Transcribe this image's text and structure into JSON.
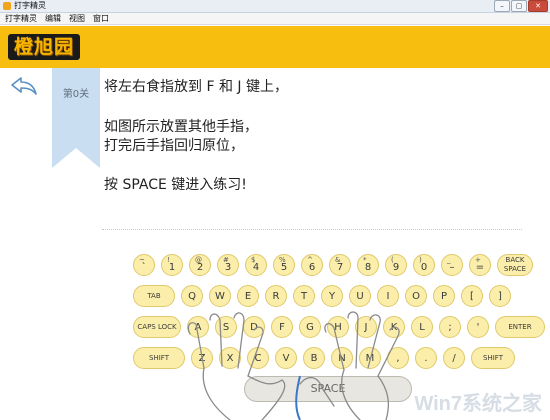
{
  "window": {
    "title": "打字精灵",
    "buttons": [
      "–",
      "▢",
      "✕"
    ]
  },
  "menu": [
    "打字精灵",
    "编辑",
    "视图",
    "窗口"
  ],
  "logo": "橙旭园",
  "lesson": {
    "label": "第0关"
  },
  "instructions": {
    "line1": "将左右食指放到 F 和 J 键上，",
    "line2": "如图所示放置其他手指，",
    "line3": "打完后手指回归原位，",
    "line4": "按 SPACE 键进入练习!"
  },
  "keyboard": {
    "row1": [
      {
        "top": "~",
        "main": "`"
      },
      {
        "top": "!",
        "main": "1"
      },
      {
        "top": "@",
        "main": "2"
      },
      {
        "top": "#",
        "main": "3"
      },
      {
        "top": "$",
        "main": "4"
      },
      {
        "top": "%",
        "main": "5"
      },
      {
        "top": "^",
        "main": "6"
      },
      {
        "top": "&",
        "main": "7"
      },
      {
        "top": "*",
        "main": "8"
      },
      {
        "top": "(",
        "main": "9"
      },
      {
        "top": ")",
        "main": "0"
      },
      {
        "top": "_",
        "main": "–"
      },
      {
        "top": "+",
        "main": "="
      }
    ],
    "backspace": "BACK SPACE",
    "row2_lead": "TAB",
    "row2": [
      "Q",
      "W",
      "E",
      "R",
      "T",
      "Y",
      "U",
      "I",
      "O",
      "P",
      "[",
      "]"
    ],
    "row3_lead": "CAPS LOCK",
    "row3": [
      "A",
      "S",
      "D",
      "F",
      "G",
      "H",
      "J",
      "K",
      "L",
      ";",
      "'"
    ],
    "enter": "ENTER",
    "shift_left": "SHIFT",
    "row4": [
      "Z",
      "X",
      "C",
      "V",
      "B",
      "N",
      "M",
      ",",
      ".",
      "/"
    ],
    "shift_right": "SHIFT",
    "space": "SPACE"
  },
  "watermark": "Win7系统之家"
}
